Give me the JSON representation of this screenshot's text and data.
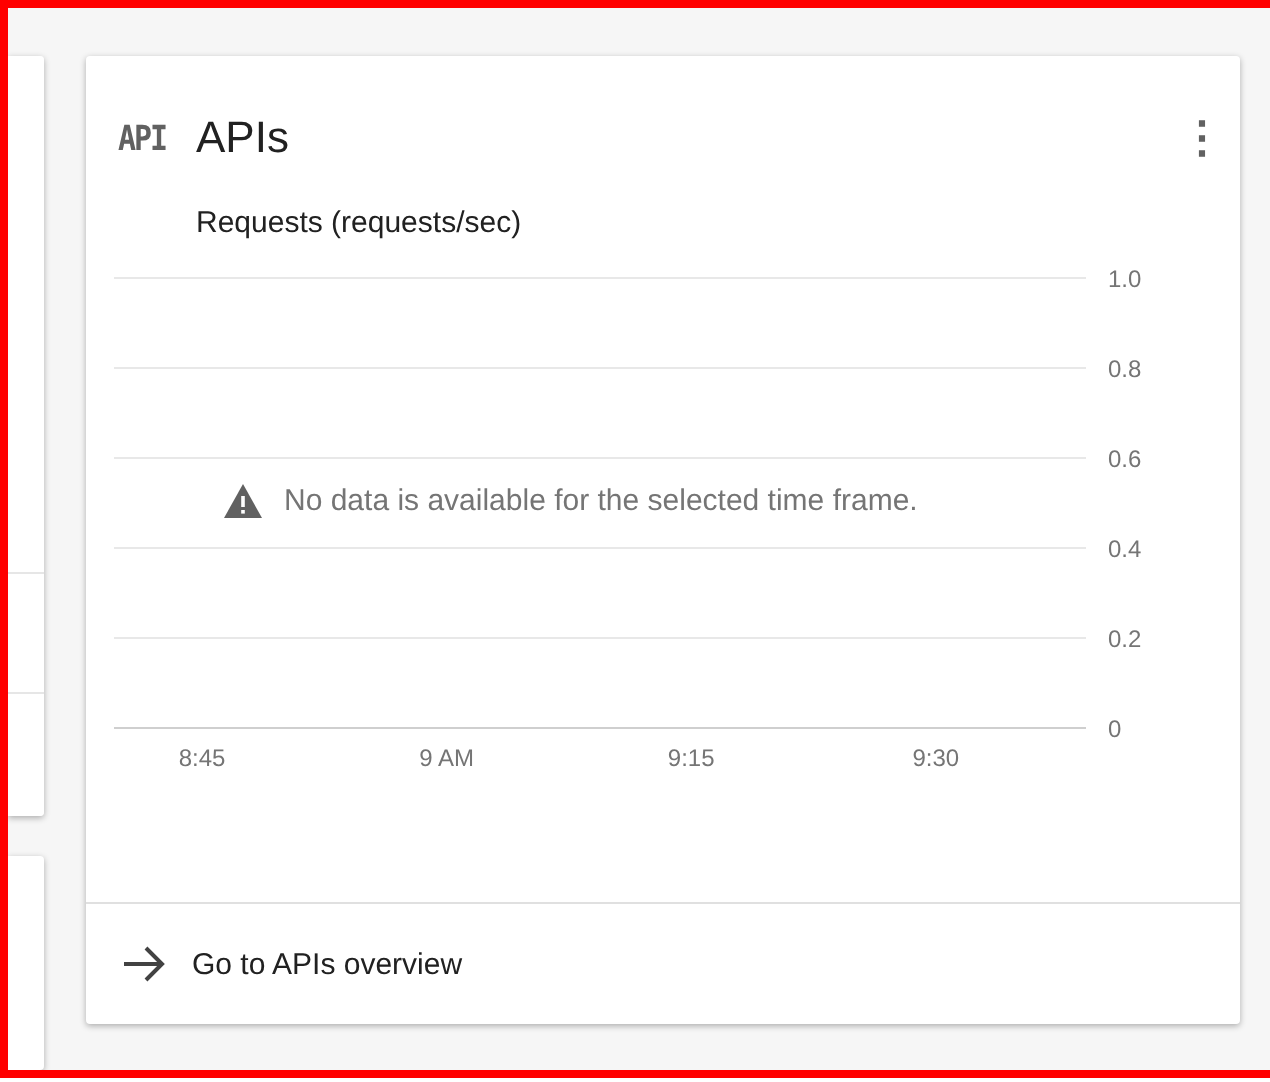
{
  "card": {
    "icon_text": "API",
    "title": "APIs",
    "menu_icon": "⋮",
    "chart": {
      "message": "No data is available for the selected time frame.",
      "chart_data": {
        "type": "line",
        "title": "Requests (requests/sec)",
        "categories": [
          "8:45",
          "9 AM",
          "9:15",
          "9:30"
        ],
        "ylim": [
          0,
          1
        ],
        "grid": true,
        "yticks": [
          {
            "value": 0,
            "label": "0"
          },
          0.2,
          0.4,
          0.6,
          0.8,
          {
            "value": 1,
            "label": "1.0"
          }
        ]
      }
    },
    "footer_link": "Go to APIs overview"
  }
}
